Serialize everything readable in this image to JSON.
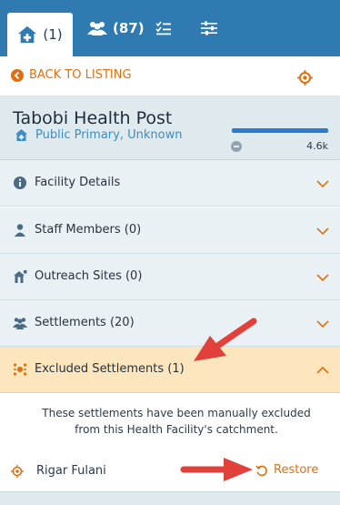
{
  "tabs": [
    {
      "label": "(1)",
      "icon": "hospital-icon",
      "active": true
    },
    {
      "label": "(87)",
      "icon": "users-icon"
    },
    {
      "label": "",
      "icon": "tasks-icon"
    },
    {
      "label": "",
      "icon": "sliders-icon"
    }
  ],
  "back": {
    "label": "BACK TO LISTING"
  },
  "facility": {
    "name": "Tabobi Health Post",
    "meta": "Public Primary, Unknown",
    "population": "4.6k",
    "population_fill": 1.0
  },
  "sections": [
    {
      "label": "Facility Details",
      "icon": "info-icon"
    },
    {
      "label": "Staff Members (0)",
      "icon": "staff-icon"
    },
    {
      "label": "Outreach Sites (0)",
      "icon": "outreach-icon"
    },
    {
      "label": "Settlements (20)",
      "icon": "users-icon"
    },
    {
      "label": "Excluded Settlements (1)",
      "icon": "excluded-settlement-icon",
      "expanded": true
    }
  ],
  "excluded": {
    "note": "These settlements have been manually excluded from this Health Facility's catchment.",
    "items": [
      {
        "name": "Rigar Fulani",
        "action": "Restore"
      }
    ]
  },
  "colors": {
    "primary": "#2f7ab0",
    "accent": "#e0700f",
    "link_blue": "#3e8cc4",
    "expanded_bg": "#fde6bd",
    "annotation_red": "#e2403b"
  }
}
